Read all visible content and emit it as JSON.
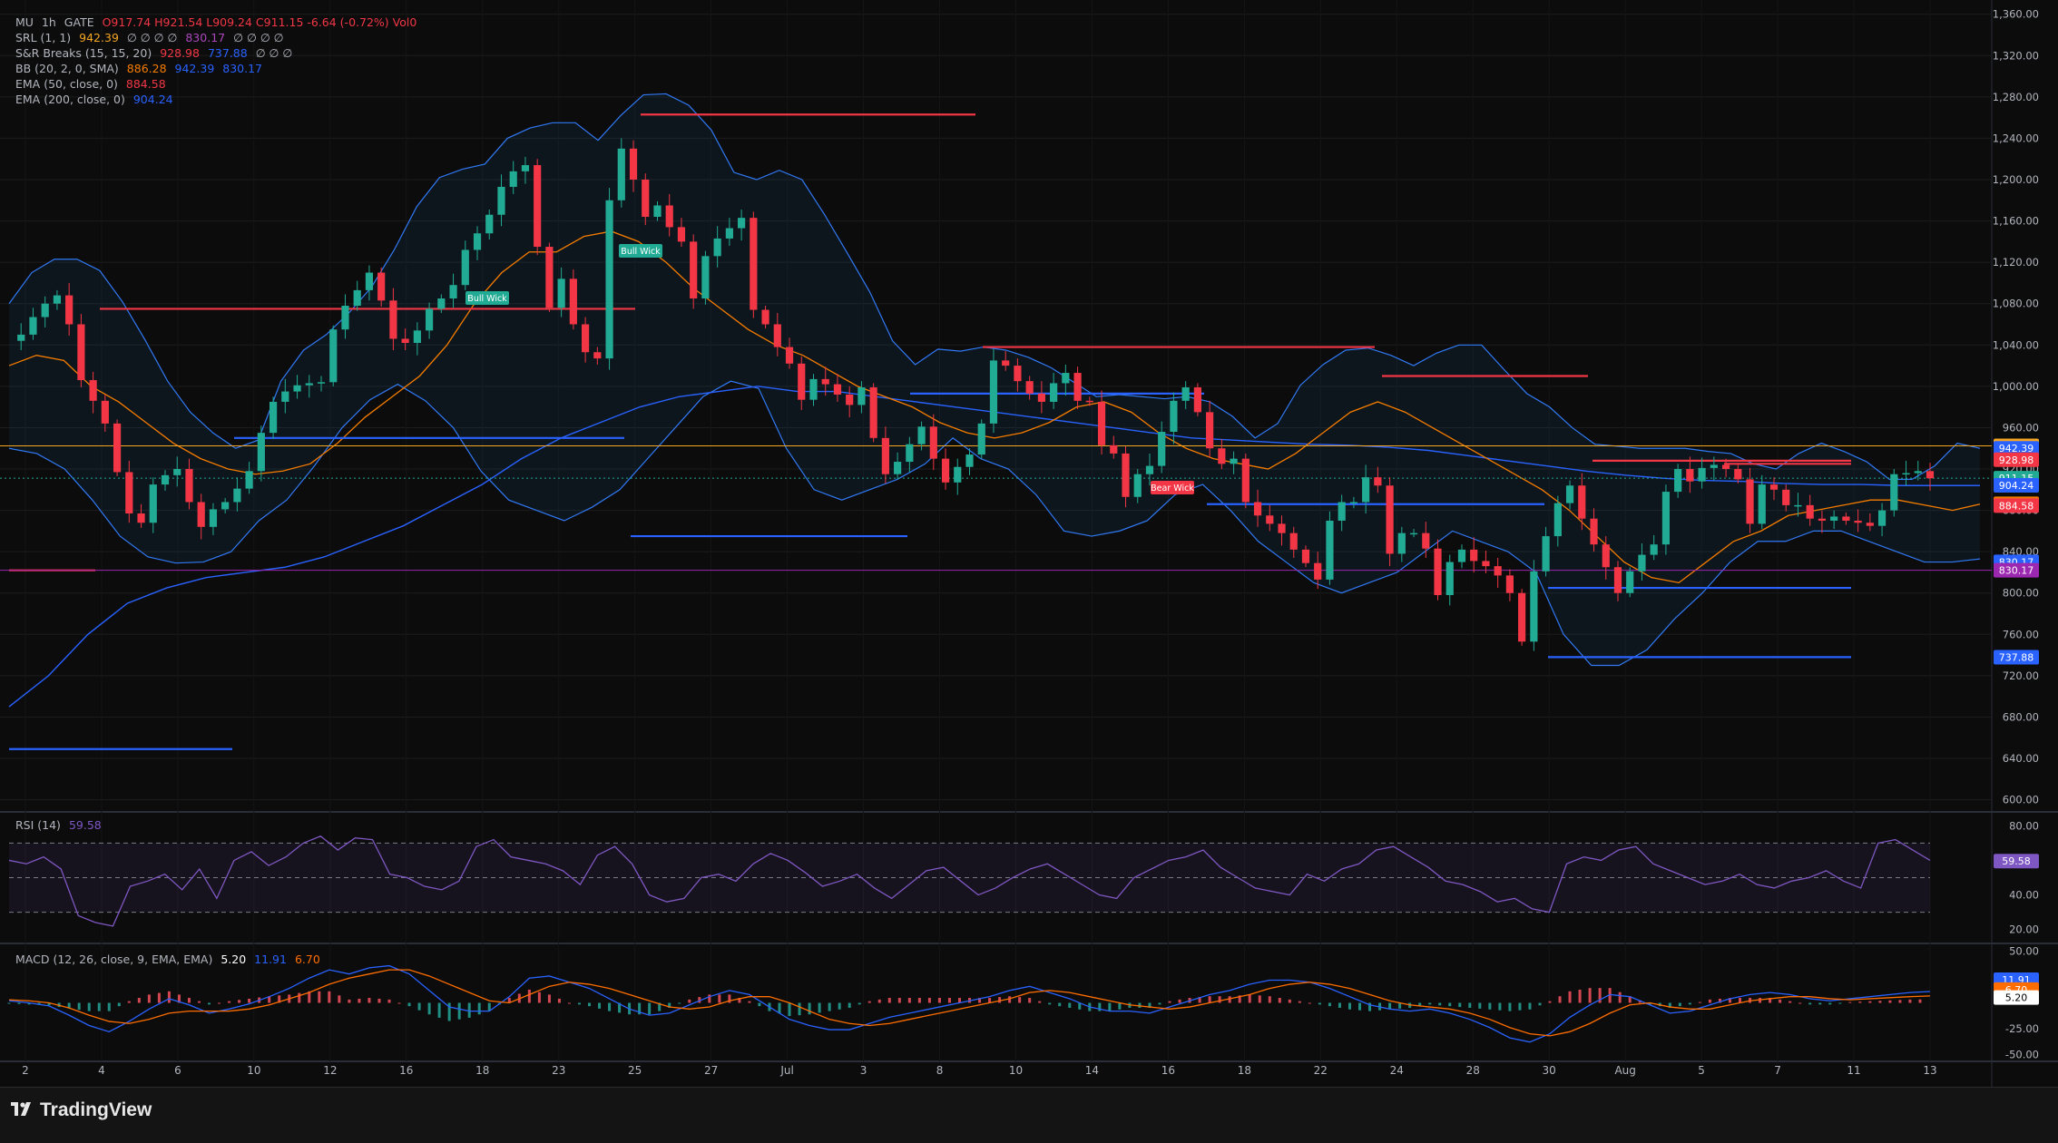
{
  "brand": {
    "name": "TradingView"
  },
  "legend": {
    "symbol": {
      "name": "MU",
      "interval": "1h",
      "exchange": "GATE",
      "ohlc": "O917.74  H921.54  L909.24  C911.15  -6.64 (-0.72%)  Vol0"
    },
    "srl": {
      "label": "SRL (1, 1)",
      "value1": "942.39",
      "dots1": "∅ ∅ ∅ ∅",
      "value2": "830.17",
      "dots2": "∅ ∅ ∅ ∅"
    },
    "snr": {
      "label": "S&R Breaks (15, 15, 20)",
      "value1": "928.98",
      "value2": "737.88",
      "dots": "∅ ∅ ∅"
    },
    "bb": {
      "label": "BB (20, 2, 0, SMA)",
      "basis": "886.28",
      "upper": "942.39",
      "lower": "830.17"
    },
    "ema50": {
      "label": "EMA (50, close, 0)",
      "value": "884.58"
    },
    "ema200": {
      "label": "EMA (200, close, 0)",
      "value": "904.24"
    },
    "rsi": {
      "label": "RSI (14)",
      "value": "59.58"
    },
    "macd": {
      "label": "MACD (12, 26, close, 9, EMA, EMA)",
      "hist": "5.20",
      "macd": "11.91",
      "signal": "6.70"
    }
  },
  "colors": {
    "bull": "#22ab94",
    "bear": "#f23645",
    "bb": "#2962ff",
    "ema50": "#f57c00",
    "ema200": "#2962ff",
    "res": "#f23645",
    "sup": "#2962ff",
    "srl_up": "#f5a623",
    "srl_dn": "#9c27b0",
    "rsi": "#7e57c2",
    "macd": "#2962ff",
    "signal": "#ff6d00"
  },
  "chart_data": {
    "type": "candlestick",
    "x_ticks": [
      "2",
      "4",
      "6",
      "10",
      "12",
      "16",
      "18",
      "23",
      "25",
      "27",
      "Jul",
      "3",
      "8",
      "10",
      "14",
      "16",
      "18",
      "22",
      "24",
      "28",
      "30",
      "Aug",
      "5",
      "7",
      "11",
      "13"
    ],
    "price_axis": {
      "ticks": [
        "1,360.00",
        "1,320.00",
        "1,280.00",
        "1,240.00",
        "1,200.00",
        "1,160.00",
        "1,120.00",
        "1,080.00",
        "1,040.00",
        "1,000.00",
        "960.00",
        "920.00",
        "880.00",
        "840.00",
        "800.00",
        "760.00",
        "720.00",
        "680.00",
        "640.00",
        "600.00"
      ],
      "range": [
        590,
        1365
      ]
    },
    "price_labels": [
      {
        "text": "942.39",
        "value": 942.39,
        "color": "#f5a623"
      },
      {
        "text": "942.39",
        "value": 940.0,
        "color": "#2962ff"
      },
      {
        "text": "928.98",
        "value": 928.98,
        "color": "#f23645"
      },
      {
        "text": "911.15",
        "value": 911.15,
        "color": "#22ab94"
      },
      {
        "text": "904.24",
        "value": 904.24,
        "color": "#2962ff"
      },
      {
        "text": "886.28",
        "value": 886.28,
        "color": "#f57c00"
      },
      {
        "text": "884.58",
        "value": 884.58,
        "color": "#f23645"
      },
      {
        "text": "830.17",
        "value": 830.17,
        "color": "#2962ff"
      },
      {
        "text": "830.17",
        "value": 822.0,
        "color": "#9c27b0"
      },
      {
        "text": "737.88",
        "value": 737.88,
        "color": "#2962ff"
      }
    ],
    "close_series": [
      1044,
      1050,
      1067,
      1080,
      1088,
      1060,
      1006,
      986,
      964,
      917,
      877,
      868,
      905,
      914,
      920,
      888,
      864,
      881,
      888,
      901,
      918,
      955,
      985,
      995,
      1001,
      1003,
      1004,
      1055,
      1078,
      1093,
      1110,
      1083,
      1046,
      1042,
      1054,
      1075,
      1085,
      1098,
      1132,
      1148,
      1166,
      1193,
      1208,
      1214,
      1135,
      1076,
      1104,
      1060,
      1033,
      1027,
      1180,
      1230,
      1200,
      1164,
      1175,
      1154,
      1140,
      1085,
      1126,
      1143,
      1153,
      1163,
      1074,
      1060,
      1038,
      1022,
      987,
      1007,
      1002,
      992,
      982,
      999,
      950,
      915,
      927,
      944,
      961,
      930,
      907,
      922,
      934,
      964,
      1025,
      1020,
      1005,
      993,
      985,
      1003,
      1013,
      986,
      985,
      943,
      935,
      893,
      915,
      923,
      956,
      986,
      999,
      975,
      940,
      925,
      930,
      888,
      875,
      867,
      858,
      842,
      829,
      813,
      870,
      888,
      888,
      912,
      904,
      838,
      858,
      858,
      843,
      798,
      830,
      842,
      831,
      826,
      817,
      800,
      753,
      821,
      855,
      887,
      904,
      872,
      847,
      825,
      800,
      821,
      837,
      847,
      898,
      920,
      908,
      921,
      924,
      920,
      910,
      867,
      905,
      900,
      885,
      885,
      872,
      870,
      874,
      870,
      868,
      865,
      880,
      915,
      916,
      918,
      911
    ],
    "bb_upper_series": [
      1080,
      1110,
      1123,
      1123,
      1112,
      1082,
      1045,
      1005,
      975,
      955,
      940,
      948,
      1005,
      1035,
      1050,
      1071,
      1096,
      1132,
      1174,
      1202,
      1210,
      1215,
      1240,
      1250,
      1255,
      1255,
      1238,
      1262,
      1282,
      1283,
      1272,
      1248,
      1207,
      1200,
      1209,
      1200,
      1166,
      1129,
      1091,
      1044,
      1021,
      1036,
      1034,
      1038,
      1035,
      1028,
      1018,
      1004,
      990,
      992,
      990,
      988,
      990,
      985,
      971,
      950,
      964,
      1001,
      1021,
      1035,
      1037,
      1030,
      1020,
      1032,
      1040,
      1040,
      1016,
      993,
      980,
      960,
      944,
      942,
      940,
      940,
      940,
      937,
      935,
      925,
      920,
      935,
      945,
      937,
      927,
      910,
      910,
      923,
      945,
      940
    ],
    "bb_lower_series": [
      940,
      935,
      920,
      890,
      855,
      835,
      829,
      830,
      840,
      870,
      890,
      923,
      960,
      987,
      1002,
      986,
      960,
      918,
      890,
      880,
      870,
      883,
      900,
      930,
      960,
      990,
      1005,
      998,
      940,
      900,
      890,
      900,
      910,
      925,
      950,
      930,
      920,
      895,
      860,
      855,
      860,
      870,
      895,
      905,
      880,
      850,
      830,
      810,
      800,
      810,
      820,
      840,
      860,
      850,
      840,
      820,
      760,
      730,
      730,
      745,
      775,
      800,
      830,
      850,
      850,
      860,
      860,
      850,
      840,
      830,
      830,
      833
    ],
    "ema50_series": [
      1020,
      1030,
      1025,
      1000,
      985,
      965,
      945,
      930,
      920,
      915,
      918,
      925,
      945,
      970,
      990,
      1010,
      1040,
      1080,
      1110,
      1130,
      1130,
      1145,
      1150,
      1140,
      1120,
      1095,
      1075,
      1055,
      1040,
      1030,
      1015,
      1000,
      990,
      980,
      965,
      955,
      950,
      955,
      965,
      980,
      985,
      975,
      955,
      940,
      930,
      925,
      920,
      935,
      955,
      975,
      985,
      975,
      960,
      945,
      930,
      915,
      900,
      880,
      855,
      830,
      815,
      810,
      830,
      850,
      860,
      875,
      880,
      885,
      890,
      890,
      885,
      880,
      886
    ],
    "ema200_series": [
      690,
      720,
      760,
      790,
      805,
      815,
      820,
      825,
      835,
      850,
      865,
      885,
      905,
      930,
      950,
      965,
      980,
      990,
      995,
      1000,
      995,
      995,
      990,
      985,
      980,
      975,
      970,
      965,
      960,
      955,
      950,
      948,
      946,
      944,
      943,
      941,
      938,
      933,
      928,
      923,
      918,
      914,
      911,
      909,
      908,
      906,
      905,
      905,
      904,
      904,
      904
    ],
    "resistance_lines": [
      [
        1075,
        1075
      ],
      [
        1097,
        1097
      ],
      [
        1263,
        1263
      ],
      [
        1038,
        1038
      ],
      [
        1010,
        1010
      ],
      [
        928,
        928
      ],
      [
        925,
        925
      ],
      [
        822,
        822
      ]
    ],
    "support_lines": [
      [
        950,
        950
      ],
      [
        855,
        855
      ],
      [
        993,
        993
      ],
      [
        886,
        886
      ],
      [
        805,
        805
      ],
      [
        738,
        738
      ],
      [
        649,
        649
      ]
    ],
    "annotations": [
      {
        "text": "Bull Wick"
      },
      {
        "text": "Bull Wick"
      },
      {
        "text": "Bear Wick"
      }
    ],
    "rsi": {
      "label": "RSI (14)",
      "axis_ticks": [
        "80.00",
        "60.00",
        "40.00",
        "20.00"
      ],
      "range": [
        13,
        87
      ],
      "bands": [
        70,
        50,
        30
      ],
      "series": [
        60,
        58,
        62,
        55,
        28,
        24,
        22,
        45,
        48,
        52,
        43,
        55,
        38,
        60,
        65,
        57,
        62,
        70,
        74,
        66,
        73,
        72,
        52,
        50,
        45,
        43,
        48,
        68,
        72,
        62,
        60,
        58,
        54,
        46,
        63,
        68,
        58,
        40,
        36,
        38,
        50,
        52,
        48,
        58,
        64,
        60,
        53,
        45,
        48,
        52,
        44,
        38,
        46,
        54,
        56,
        48,
        40,
        44,
        50,
        55,
        58,
        52,
        46,
        40,
        38,
        50,
        55,
        60,
        62,
        66,
        56,
        50,
        44,
        42,
        40,
        52,
        48,
        55,
        58,
        66,
        68,
        62,
        56,
        48,
        46,
        42,
        36,
        38,
        32,
        30,
        58,
        62,
        60,
        66,
        68,
        58,
        54,
        50,
        46,
        48,
        52,
        46,
        44,
        48,
        50,
        54,
        48,
        44,
        70,
        72,
        66,
        60
      ]
    },
    "macd": {
      "label": "MACD (12, 26, close, 9, EMA, EMA)",
      "axis_ticks": [
        "50.00",
        "25.00",
        "-25.00",
        "-50.00"
      ],
      "range": [
        -55,
        55
      ],
      "macd_series": [
        2,
        0,
        -3,
        -12,
        -22,
        -28,
        -18,
        -6,
        4,
        -2,
        -10,
        -6,
        -1,
        6,
        14,
        24,
        32,
        28,
        34,
        36,
        28,
        12,
        -4,
        -8,
        -8,
        6,
        24,
        26,
        20,
        14,
        4,
        -6,
        -12,
        -10,
        -2,
        6,
        12,
        8,
        -4,
        -16,
        -22,
        -26,
        -26,
        -20,
        -14,
        -10,
        -6,
        -2,
        2,
        6,
        12,
        16,
        10,
        4,
        -4,
        -8,
        -8,
        -10,
        -4,
        2,
        8,
        12,
        18,
        22,
        22,
        20,
        14,
        6,
        -2,
        -6,
        -8,
        -6,
        -10,
        -16,
        -24,
        -34,
        -38,
        -30,
        -14,
        -2,
        8,
        6,
        -2,
        -10,
        -8,
        -2,
        4,
        8,
        10,
        8,
        4,
        2,
        4,
        6,
        8,
        10,
        11
      ],
      "signal_series": [
        3,
        2,
        0,
        -5,
        -12,
        -18,
        -20,
        -16,
        -10,
        -8,
        -8,
        -8,
        -6,
        -2,
        4,
        10,
        18,
        24,
        28,
        32,
        32,
        26,
        18,
        10,
        2,
        0,
        8,
        16,
        20,
        18,
        14,
        8,
        2,
        -4,
        -6,
        -4,
        2,
        6,
        6,
        0,
        -8,
        -16,
        -20,
        -22,
        -20,
        -16,
        -12,
        -8,
        -4,
        0,
        4,
        10,
        12,
        10,
        6,
        2,
        -2,
        -4,
        -6,
        -4,
        0,
        4,
        8,
        14,
        18,
        20,
        18,
        14,
        8,
        2,
        -2,
        -4,
        -6,
        -10,
        -16,
        -24,
        -30,
        -32,
        -28,
        -20,
        -10,
        -2,
        0,
        -4,
        -6,
        -6,
        -2,
        2,
        4,
        6,
        6,
        4,
        3,
        4,
        5,
        6,
        6.7
      ]
    }
  }
}
